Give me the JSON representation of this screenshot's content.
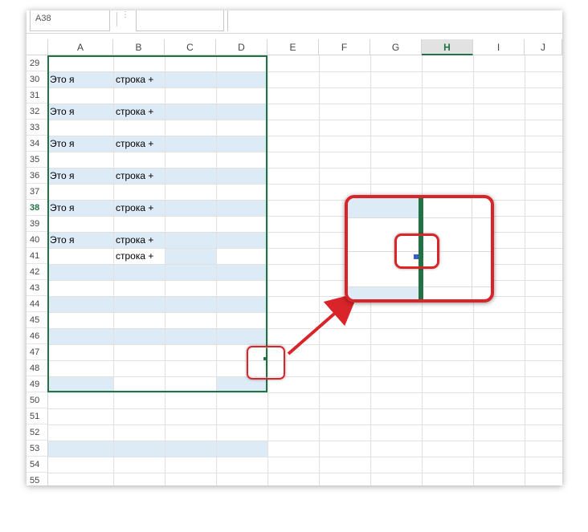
{
  "formula_bar": {
    "name_box": "A38"
  },
  "columns": [
    "A",
    "B",
    "C",
    "D",
    "E",
    "F",
    "G",
    "H",
    "I",
    "J"
  ],
  "selected_column": "H",
  "rows": [
    "29",
    "30",
    "31",
    "32",
    "33",
    "34",
    "35",
    "36",
    "37",
    "38",
    "39",
    "40",
    "41",
    "42",
    "43",
    "44",
    "45",
    "46",
    "47",
    "48",
    "49",
    "50",
    "51",
    "52",
    "53",
    "54",
    "55"
  ],
  "selected_row": "38",
  "cells": [
    {
      "row": "30",
      "a": "Это я",
      "b": "строка +"
    },
    {
      "row": "32",
      "a": "Это я",
      "b": "строка +"
    },
    {
      "row": "34",
      "a": "Это я",
      "b": "строка +"
    },
    {
      "row": "36",
      "a": "Это я",
      "b": "строка +"
    },
    {
      "row": "38",
      "a": "Это я",
      "b": "строка +"
    },
    {
      "row": "40",
      "a": "Это я",
      "b": "строка +"
    },
    {
      "row": "41",
      "a": "",
      "b": "строка +"
    }
  ],
  "colors": {
    "accent": "#217346",
    "fill": "#ddebf7",
    "callout": "#d9252a"
  },
  "icons": {
    "fill_handle": "fill-handle-icon",
    "arrow": "arrow-icon"
  }
}
